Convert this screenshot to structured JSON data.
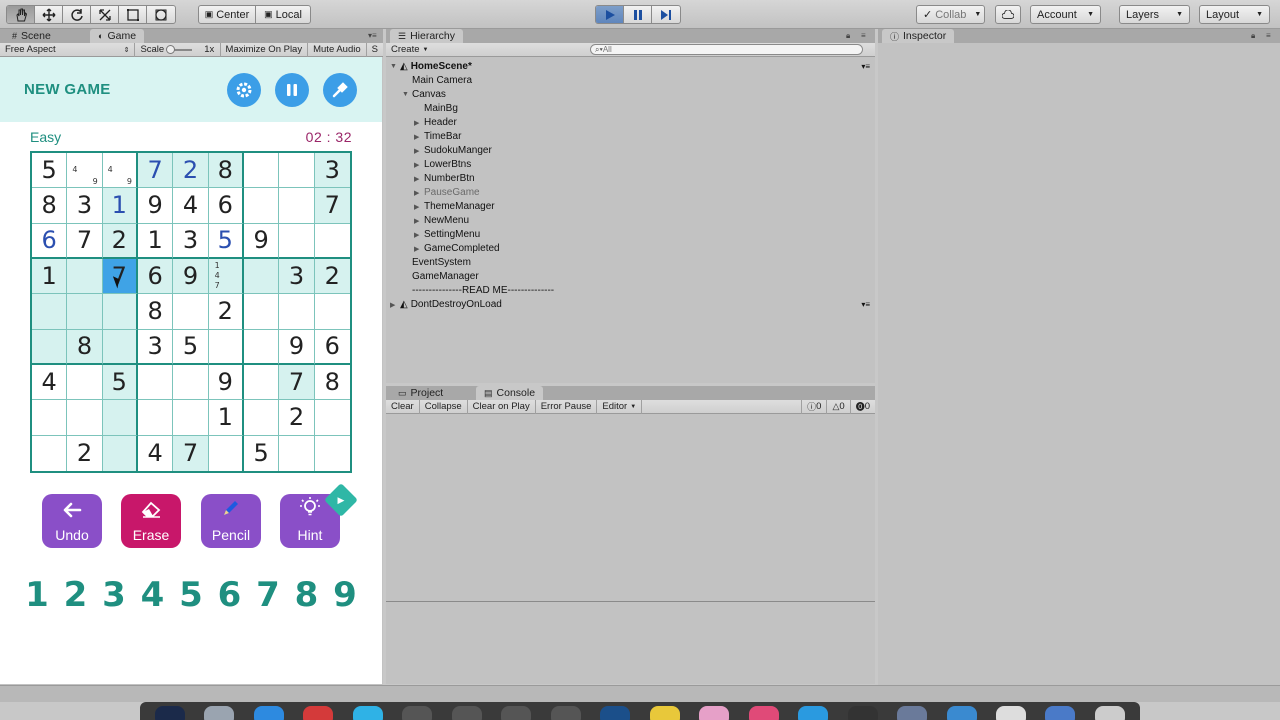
{
  "toolbar": {
    "pivot_label": "Center",
    "space_label": "Local",
    "collab_label": "Collab",
    "account_label": "Account",
    "layers_label": "Layers",
    "layout_label": "Layout"
  },
  "scene_tabs": {
    "scene": "Scene",
    "game": "Game"
  },
  "game_toolbar": {
    "aspect": "Free Aspect",
    "scale_label": "Scale",
    "scale_value": "1x",
    "maximize": "Maximize On Play",
    "mute": "Mute Audio",
    "stats": "S"
  },
  "game": {
    "new_game": "NEW GAME",
    "difficulty": "Easy",
    "timer": "02 : 32",
    "board": [
      [
        {
          "v": "5"
        },
        {
          "notes": [
            "4",
            "9"
          ]
        },
        {
          "notes": [
            "4",
            "9"
          ]
        },
        {
          "v": "7",
          "user": true,
          "hl": true
        },
        {
          "v": "2",
          "user": true,
          "hl": true
        },
        {
          "v": "8",
          "hl": true
        },
        {
          "v": ""
        },
        {
          "v": ""
        },
        {
          "v": "3",
          "hl": true
        }
      ],
      [
        {
          "v": "8"
        },
        {
          "v": "3"
        },
        {
          "v": "1",
          "user": true,
          "hl": true
        },
        {
          "v": "9"
        },
        {
          "v": "4"
        },
        {
          "v": "6"
        },
        {
          "v": ""
        },
        {
          "v": ""
        },
        {
          "v": "7",
          "hl": true
        }
      ],
      [
        {
          "v": "6",
          "user": true
        },
        {
          "v": "7"
        },
        {
          "v": "2",
          "hl": true
        },
        {
          "v": "1"
        },
        {
          "v": "3"
        },
        {
          "v": "5",
          "user": true
        },
        {
          "v": "9"
        },
        {
          "v": ""
        },
        {
          "v": ""
        }
      ],
      [
        {
          "v": "1",
          "hl": true
        },
        {
          "v": "",
          "hl": true
        },
        {
          "v": "7",
          "sel": true
        },
        {
          "v": "6",
          "hl": true
        },
        {
          "v": "9",
          "hl": true
        },
        {
          "notes": [
            "1",
            "4",
            "7"
          ],
          "hl": true
        },
        {
          "v": "",
          "hl": true
        },
        {
          "v": "3",
          "hl": true
        },
        {
          "v": "2",
          "hl": true
        }
      ],
      [
        {
          "v": "",
          "hl": true
        },
        {
          "v": "",
          "hl": true
        },
        {
          "v": "",
          "hl": true
        },
        {
          "v": "8"
        },
        {
          "v": ""
        },
        {
          "v": "2"
        },
        {
          "v": ""
        },
        {
          "v": ""
        },
        {
          "v": ""
        }
      ],
      [
        {
          "v": "",
          "hl": true
        },
        {
          "v": "8",
          "hl": true
        },
        {
          "v": "",
          "hl": true
        },
        {
          "v": "3"
        },
        {
          "v": "5"
        },
        {
          "v": ""
        },
        {
          "v": ""
        },
        {
          "v": "9"
        },
        {
          "v": "6"
        }
      ],
      [
        {
          "v": "4"
        },
        {
          "v": ""
        },
        {
          "v": "5",
          "hl": true
        },
        {
          "v": ""
        },
        {
          "v": ""
        },
        {
          "v": "9"
        },
        {
          "v": ""
        },
        {
          "v": "7",
          "hl": true
        },
        {
          "v": "8"
        }
      ],
      [
        {
          "v": ""
        },
        {
          "v": ""
        },
        {
          "v": "",
          "hl": true
        },
        {
          "v": ""
        },
        {
          "v": ""
        },
        {
          "v": "1"
        },
        {
          "v": ""
        },
        {
          "v": "2"
        },
        {
          "v": ""
        }
      ],
      [
        {
          "v": ""
        },
        {
          "v": "2"
        },
        {
          "v": "",
          "hl": true
        },
        {
          "v": "4"
        },
        {
          "v": "7",
          "hl": true
        },
        {
          "v": ""
        },
        {
          "v": "5"
        },
        {
          "v": ""
        },
        {
          "v": ""
        }
      ]
    ],
    "actions": [
      {
        "label": "Undo",
        "color": "#8a4fc8",
        "icon": "undo-icon"
      },
      {
        "label": "Erase",
        "color": "#c8176a",
        "icon": "eraser-icon"
      },
      {
        "label": "Pencil",
        "color": "#8a4fc8",
        "icon": "pencil-icon"
      },
      {
        "label": "Hint",
        "color": "#8a4fc8",
        "icon": "lightbulb-icon"
      }
    ],
    "numbers": [
      "1",
      "2",
      "3",
      "4",
      "5",
      "6",
      "7",
      "8",
      "9"
    ]
  },
  "hierarchy": {
    "tab": "Hierarchy",
    "create": "Create",
    "search_placeholder": "All",
    "scene": "HomeScene*",
    "items": [
      {
        "label": "Main Camera",
        "depth": 1,
        "arrow": ""
      },
      {
        "label": "Canvas",
        "depth": 1,
        "arrow": "open"
      },
      {
        "label": "MainBg",
        "depth": 2,
        "arrow": ""
      },
      {
        "label": "Header",
        "depth": 2,
        "arrow": "closed"
      },
      {
        "label": "TimeBar",
        "depth": 2,
        "arrow": "closed"
      },
      {
        "label": "SudokuManger",
        "depth": 2,
        "arrow": "closed"
      },
      {
        "label": "LowerBtns",
        "depth": 2,
        "arrow": "closed"
      },
      {
        "label": "NumberBtn",
        "depth": 2,
        "arrow": "closed"
      },
      {
        "label": "PauseGame",
        "depth": 2,
        "arrow": "closed",
        "dim": true
      },
      {
        "label": "ThemeManager",
        "depth": 2,
        "arrow": "closed"
      },
      {
        "label": "NewMenu",
        "depth": 2,
        "arrow": "closed"
      },
      {
        "label": "SettingMenu",
        "depth": 2,
        "arrow": "closed"
      },
      {
        "label": "GameCompleted",
        "depth": 2,
        "arrow": "closed"
      },
      {
        "label": "EventSystem",
        "depth": 1,
        "arrow": ""
      },
      {
        "label": "GameManager",
        "depth": 1,
        "arrow": ""
      },
      {
        "label": "---------------READ ME--------------",
        "depth": 1,
        "arrow": ""
      }
    ],
    "dont_destroy": "DontDestroyOnLoad"
  },
  "console": {
    "project_tab": "Project",
    "console_tab": "Console",
    "clear": "Clear",
    "collapse": "Collapse",
    "clear_on_play": "Clear on Play",
    "error_pause": "Error Pause",
    "editor": "Editor",
    "info_count": "0",
    "warn_count": "0",
    "error_count": "0"
  },
  "inspector": {
    "tab": "Inspector"
  }
}
